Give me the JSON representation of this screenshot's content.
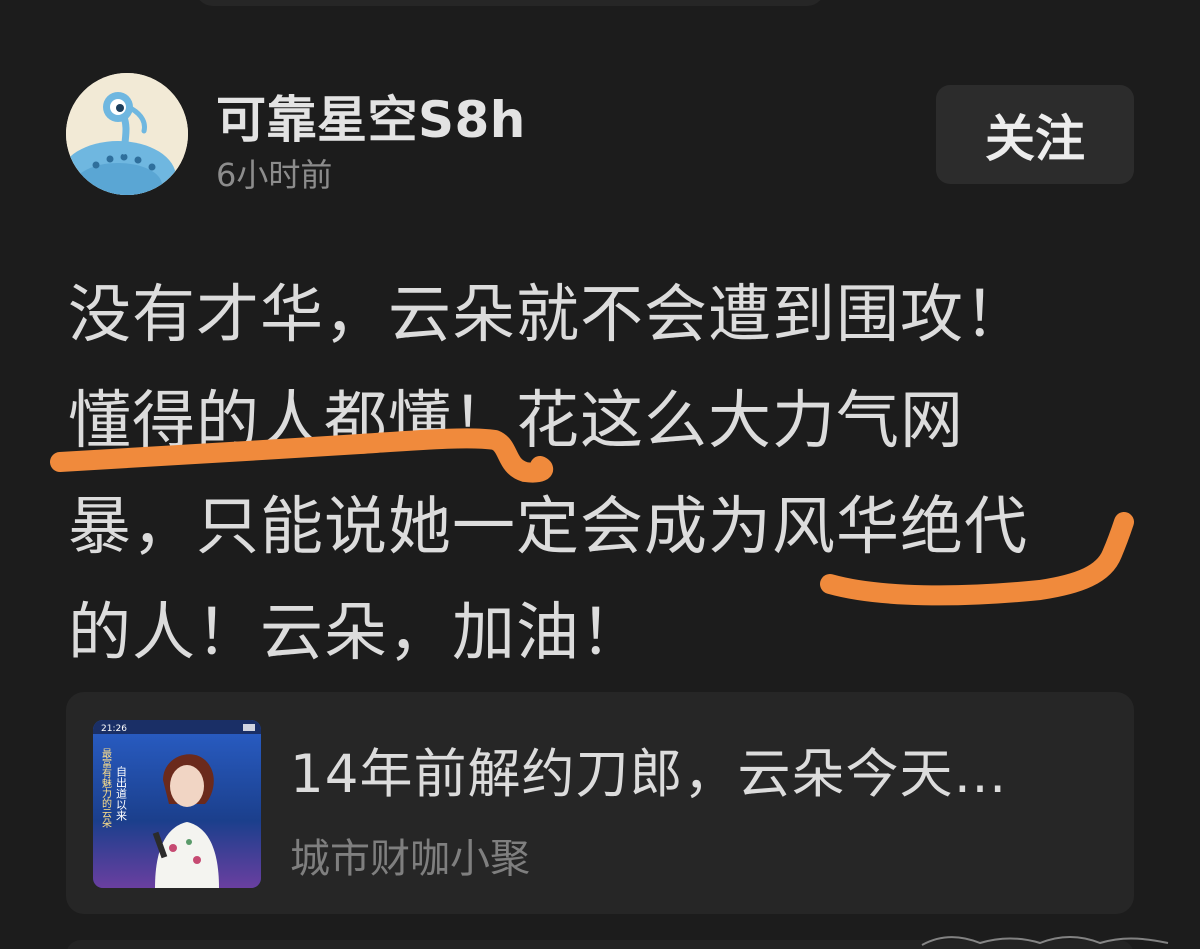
{
  "post": {
    "author": "可靠星空S8h",
    "time": "6小时前",
    "follow_label": "关注",
    "lines": [
      "没有才华，云朵就不会遭到围攻！",
      "懂得的人都懂！花这么大力气网",
      "暴，只能说她一定会成为风华绝代",
      "的人！云朵，加油！"
    ]
  },
  "link_card": {
    "title": "14年前解约刀郎，云朵今天…",
    "source": "城市财咖小聚",
    "thumbnail": {
      "status_time": "21:26",
      "caption_a": "自出道以来",
      "caption_b": "最富有魅力的云朵"
    }
  },
  "colors": {
    "background": "#1c1c1c",
    "card": "#262626",
    "highlight_stroke": "#f08a3c"
  },
  "icons": {
    "avatar": "alien-avatar-icon"
  }
}
